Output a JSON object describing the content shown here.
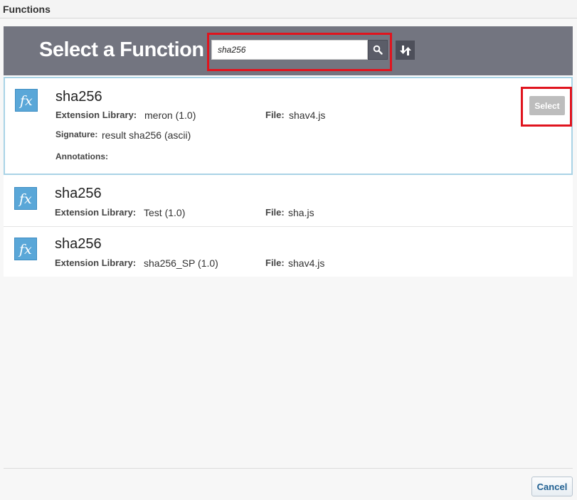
{
  "dialog": {
    "title": "Functions"
  },
  "banner": {
    "heading": "Select a Function",
    "search": {
      "value": "sha256",
      "placeholder": ""
    },
    "search_icon": "search-icon",
    "sort_icon": "sort-icon"
  },
  "results": [
    {
      "name": "sha256",
      "library_label": "Extension Library:",
      "library": "meron (1.0)",
      "file_label": "File:",
      "file": "shav4.js",
      "signature_label": "Signature:",
      "signature": "result sha256 (ascii)",
      "annotations_label": "Annotations:",
      "select_label": "Select",
      "selected": true
    },
    {
      "name": "sha256",
      "library_label": "Extension Library:",
      "library": "Test (1.0)",
      "file_label": "File:",
      "file": "sha.js"
    },
    {
      "name": "sha256",
      "library_label": "Extension Library:",
      "library": "sha256_SP (1.0)",
      "file_label": "File:",
      "file": "shav4.js"
    }
  ],
  "footer": {
    "cancel_label": "Cancel"
  },
  "colors": {
    "banner": "#737580",
    "highlight": "#e0141e",
    "selected_border": "#a9d3e6",
    "fx_icon": "#5aa7d8",
    "cancel_text": "#1f5f91"
  }
}
